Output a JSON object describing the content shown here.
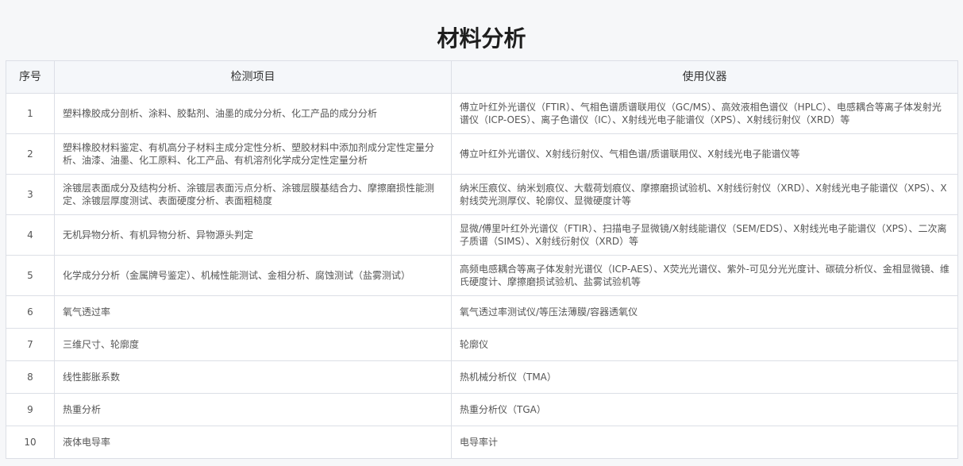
{
  "page": {
    "title": "材料分析"
  },
  "table": {
    "headers": [
      "序号",
      "检测项目",
      "使用仪器"
    ],
    "rows": [
      {
        "index": "1",
        "item": "塑料橡胶成分剖析、涂料、胶黏剂、油墨的成分分析、化工产品的成分分析",
        "instruments": "傅立叶红外光谱仪（FTIR）、气相色谱质谱联用仪（GC/MS）、高效液相色谱仪（HPLC）、电感耦合等离子体发射光谱仪（ICP-OES）、离子色谱仪（IC）、X射线光电子能谱仪（XPS）、X射线衍射仪（XRD）等"
      },
      {
        "index": "2",
        "item": "塑料橡胶材料鉴定、有机高分子材料主成分定性分析、塑胶材料中添加剂成分定性定量分析、油漆、油墨、化工原料、化工产品、有机溶剂化学成分定性定量分析",
        "instruments": "傅立叶红外光谱仪、X射线衍射仪、气相色谱/质谱联用仪、X射线光电子能谱仪等"
      },
      {
        "index": "3",
        "item": "涂镀层表面成分及结构分析、涂镀层表面污点分析、涂镀层膜基结合力、摩擦磨损性能测定、涂镀层厚度测试、表面硬度分析、表面粗糙度",
        "instruments": "纳米压痕仪、纳米划痕仪、大载荷划痕仪、摩擦磨损试验机、X射线衍射仪（XRD）、X射线光电子能谱仪（XPS）、X射线荧光测厚仪、轮廓仪、显微硬度计等"
      },
      {
        "index": "4",
        "item": "无机异物分析、有机异物分析、异物源头判定",
        "instruments": "显微/傅里叶红外光谱仪（FTIR）、扫描电子显微镜/X射线能谱仪（SEM/EDS）、X射线光电子能谱仪（XPS）、二次离子质谱（SIMS）、X射线衍射仪（XRD）等"
      },
      {
        "index": "5",
        "item": "化学成分分析（金属牌号鉴定）、机械性能测试、金相分析、腐蚀测试（盐雾测试）",
        "instruments": "高频电感耦合等离子体发射光谱仪（ICP-AES）、X荧光光谱仪、紫外-可见分光光度计、碳硫分析仪、金相显微镜、维氏硬度计、摩擦磨损试验机、盐雾试验机等"
      },
      {
        "index": "6",
        "item": "氧气透过率",
        "instruments": "氧气透过率测试仪/等压法薄膜/容器透氧仪"
      },
      {
        "index": "7",
        "item": "三维尺寸、轮廓度",
        "instruments": "轮廓仪"
      },
      {
        "index": "8",
        "item": "线性膨胀系数",
        "instruments": "热机械分析仪（TMA）"
      },
      {
        "index": "9",
        "item": "热重分析",
        "instruments": "热重分析仪（TGA）"
      },
      {
        "index": "10",
        "item": "液体电导率",
        "instruments": "电导率计"
      }
    ]
  }
}
